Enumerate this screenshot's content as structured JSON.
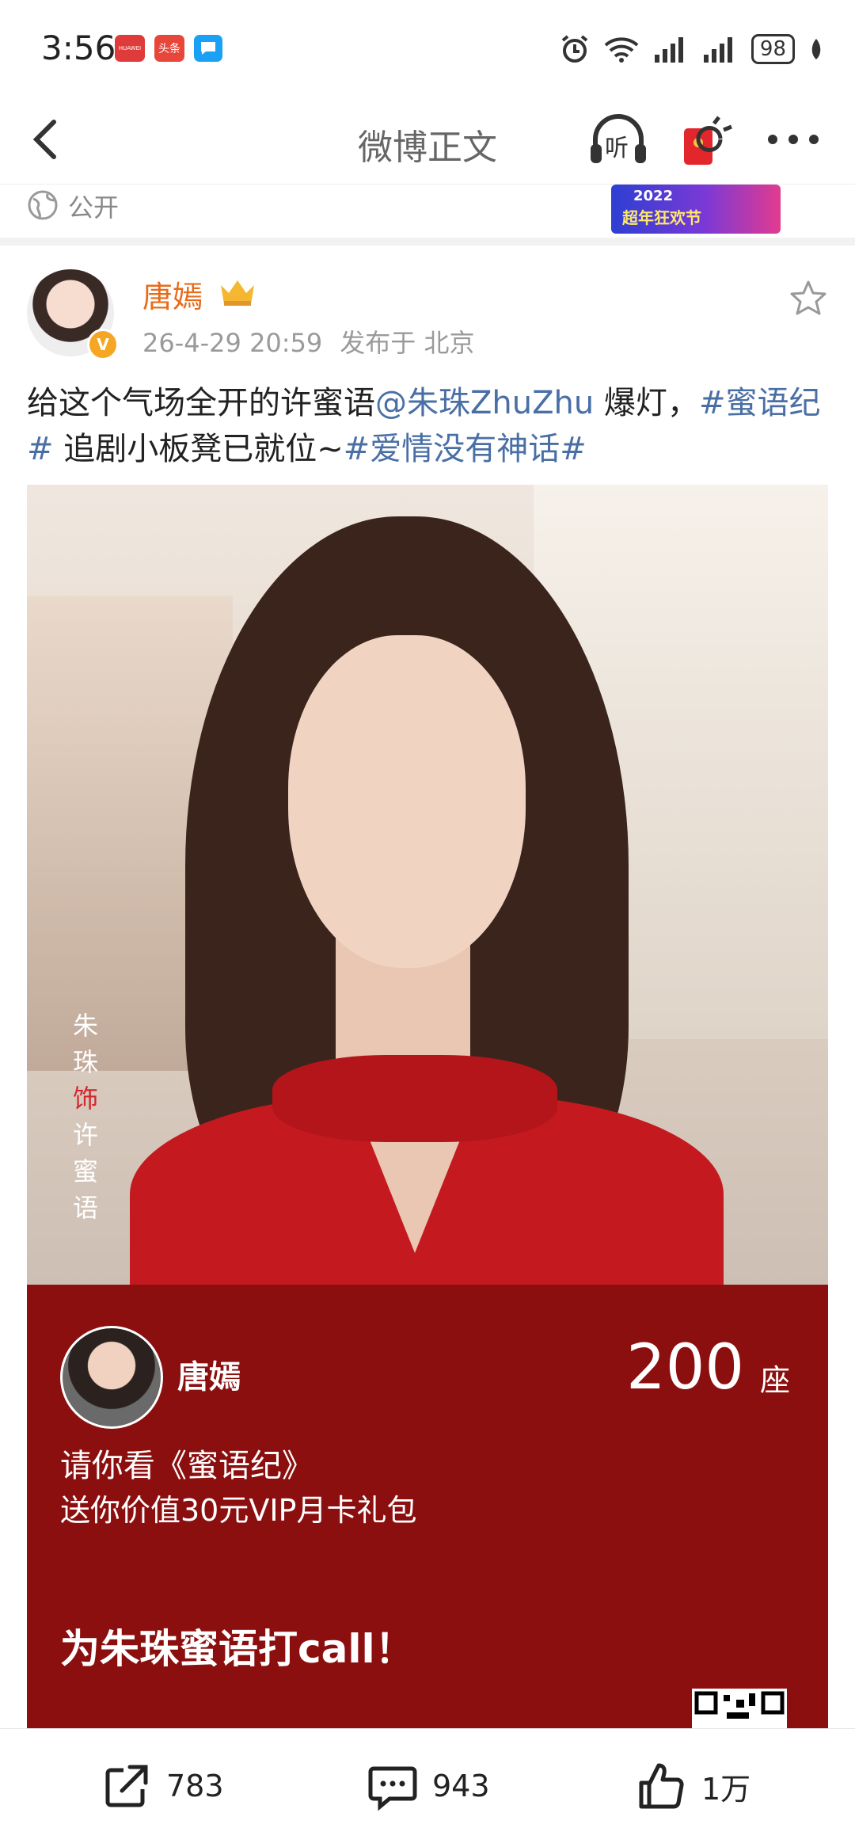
{
  "status_bar": {
    "time": "3:56",
    "badges": [
      "HUAWEI",
      "头条",
      ""
    ],
    "battery": "98"
  },
  "nav": {
    "title": "微博正文",
    "listen_label": "听"
  },
  "prev_post": {
    "visibility": "公开",
    "banner_year": "2022",
    "banner_name": "超年狂欢节"
  },
  "post": {
    "author": "唐嫣",
    "verified_mark": "V",
    "timestamp": "26-4-29 20:59",
    "location": "发布于 北京",
    "text_1": "给这个气场全开的许蜜语",
    "mention": "@朱珠ZhuZhu",
    "text_2": " 爆灯，",
    "hashtag_1": "#蜜语纪#",
    "text_3": " 追剧小板凳已就位~",
    "hashtag_2": "#爱情没有神话#"
  },
  "image": {
    "caption_actor_1": "朱",
    "caption_actor_2": "珠",
    "caption_verb": "饰",
    "caption_role_1": "许",
    "caption_role_2": "蜜",
    "caption_role_3": "语",
    "promo_name": "唐嫣",
    "promo_number": "200",
    "promo_unit": "座",
    "promo_title": "请你看《蜜语纪》",
    "promo_sub": "送你价值30元VIP月卡礼包",
    "promo_cta": "为朱珠蜜语打call！"
  },
  "actions": {
    "repost_count": "783",
    "comment_count": "943",
    "like_count": "1万"
  },
  "colors": {
    "author": "#e86b1a",
    "link": "#4a6fa5",
    "promo_bg": "#8c0f0f"
  }
}
